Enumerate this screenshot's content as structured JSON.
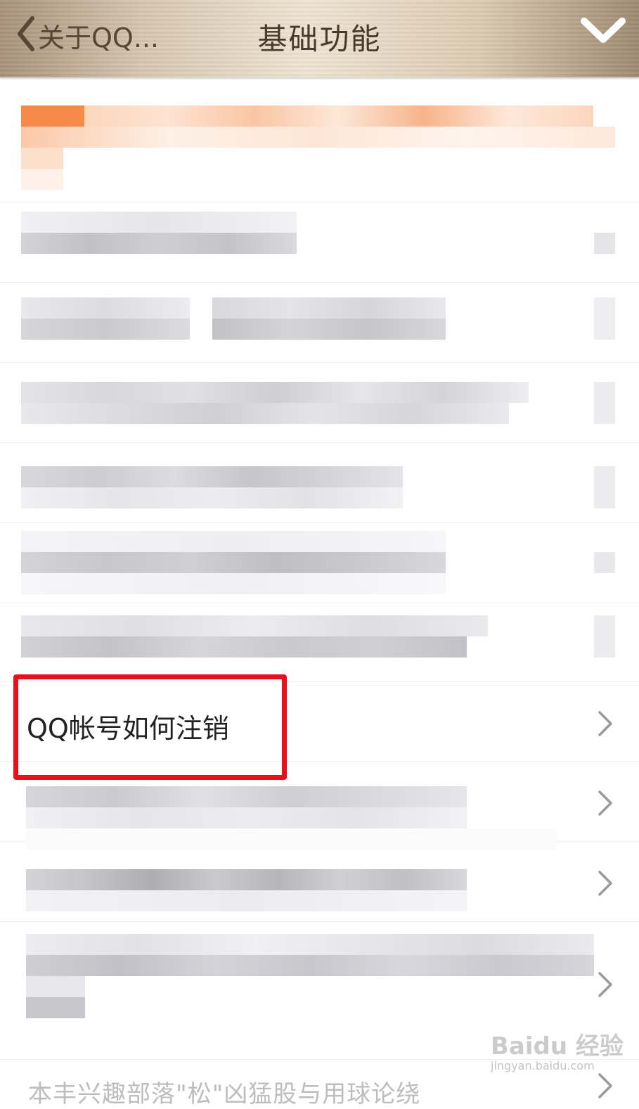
{
  "header": {
    "back_label": "关于QQ...",
    "title": "基础功能"
  },
  "faq": {
    "highlighted_item": "QQ帐号如何注销",
    "last_item_partial": "本丰兴趣部落\"松\"凶猛股与用球论绕"
  },
  "watermark": {
    "brand": "Baidu 经验",
    "url": "jingyan.baidu.com"
  },
  "colors": {
    "header_text": "#4a3a2c",
    "highlight_border": "#e8101c",
    "chevron": "#9a9a9a",
    "mosaic_orange": "#f5a06a",
    "mosaic_gray": "#c8c8cc"
  }
}
